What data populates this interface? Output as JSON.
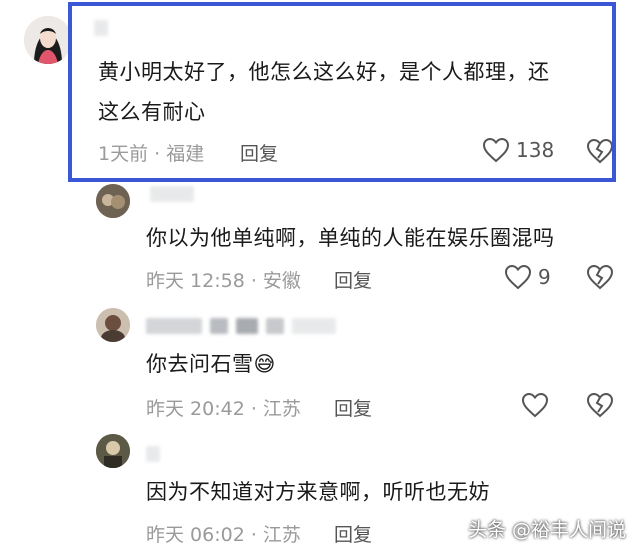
{
  "comments": [
    {
      "text_line1": "黄小明太好了，他怎么这么好，是个人都理，还",
      "text_line2": "这么有耐心",
      "meta": "1天前 · 福建",
      "reply": "回复",
      "likes": "138",
      "highlighted": true
    },
    {
      "text_line1": "你以为他单纯啊，单纯的人能在娱乐圈混吗",
      "meta": "昨天 12:58 · 安徽",
      "reply": "回复",
      "likes": "9"
    },
    {
      "text_line1": "你去问石雪",
      "emoji": "😅",
      "meta": "昨天 20:42 · 江苏",
      "reply": "回复",
      "likes": ""
    },
    {
      "text_line1": "因为不知道对方来意啊，听听也无妨",
      "meta": "昨天 06:02 · 江苏",
      "reply": "回复",
      "likes": ""
    }
  ],
  "watermark": "头条 @裕丰人间说",
  "colors": {
    "highlight_border": "#3a57d6",
    "meta_gray": "#9a9a9a"
  },
  "icons": {
    "like": "heart-outline-icon",
    "dislike": "broken-heart-icon"
  }
}
